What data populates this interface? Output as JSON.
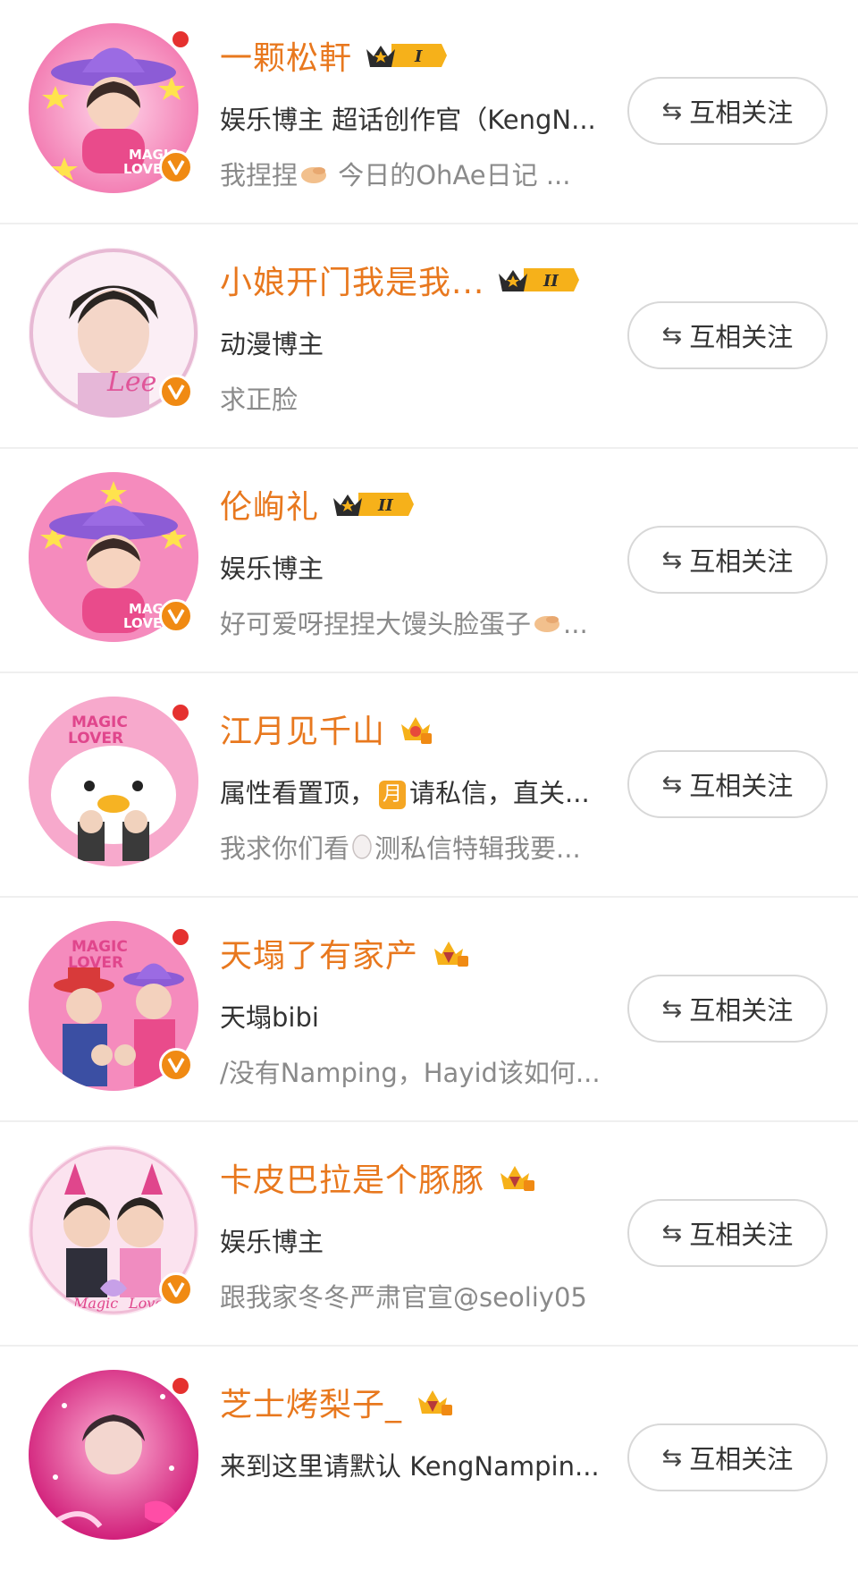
{
  "follow_button_label": "互相关注",
  "follow_button_icon": "⇆",
  "colors": {
    "name": "#e8781e",
    "verified": "#f08a13",
    "dot": "#e5312f"
  },
  "users": [
    {
      "name": "一颗松軒",
      "rank": "I",
      "sub": "娱乐博主 超话创作官（KengN...",
      "desc": "我捏捏  今日的OhAe日记 ...",
      "avatar_text": "MAGIC LOVER",
      "online_dot": true
    },
    {
      "name": "小娘开门我是我...",
      "rank": "II",
      "sub": "动漫博主",
      "desc": "求正脸",
      "avatar_text": "Lee",
      "online_dot": false
    },
    {
      "name": "伦峋礼",
      "rank": "II",
      "sub": "娱乐博主",
      "desc": "好可爱呀捏捏大馒头脸蛋子 ...",
      "avatar_text": "MAGIC LOVER",
      "online_dot": false
    },
    {
      "name": "江月见千山",
      "rank": "crown",
      "sub_a": "属性看置顶，",
      "sub_badge": "月",
      "sub_b": "请私信，直关...",
      "desc_a": "我求你们看",
      "desc_b": "测私信特辑我要...",
      "avatar_text": "MAGIC LOVER",
      "online_dot": true
    },
    {
      "name": "天塌了有家产",
      "rank": "crown",
      "sub": "天塌bibi",
      "desc": "/没有Namping，Hayid该如何...",
      "avatar_text": "MAGIC LOVER",
      "online_dot": true
    },
    {
      "name": "卡皮巴拉是个豚豚",
      "rank": "crown",
      "sub": "娱乐博主",
      "desc": "跟我家冬冬严肃官宣@seoliy05",
      "avatar_text": "Magic Lover",
      "online_dot": false
    },
    {
      "name": "芝士烤梨子_",
      "rank": "crown",
      "sub": "来到这里请默认 KengNampin...",
      "desc": "",
      "avatar_text": "",
      "online_dot": true
    }
  ]
}
